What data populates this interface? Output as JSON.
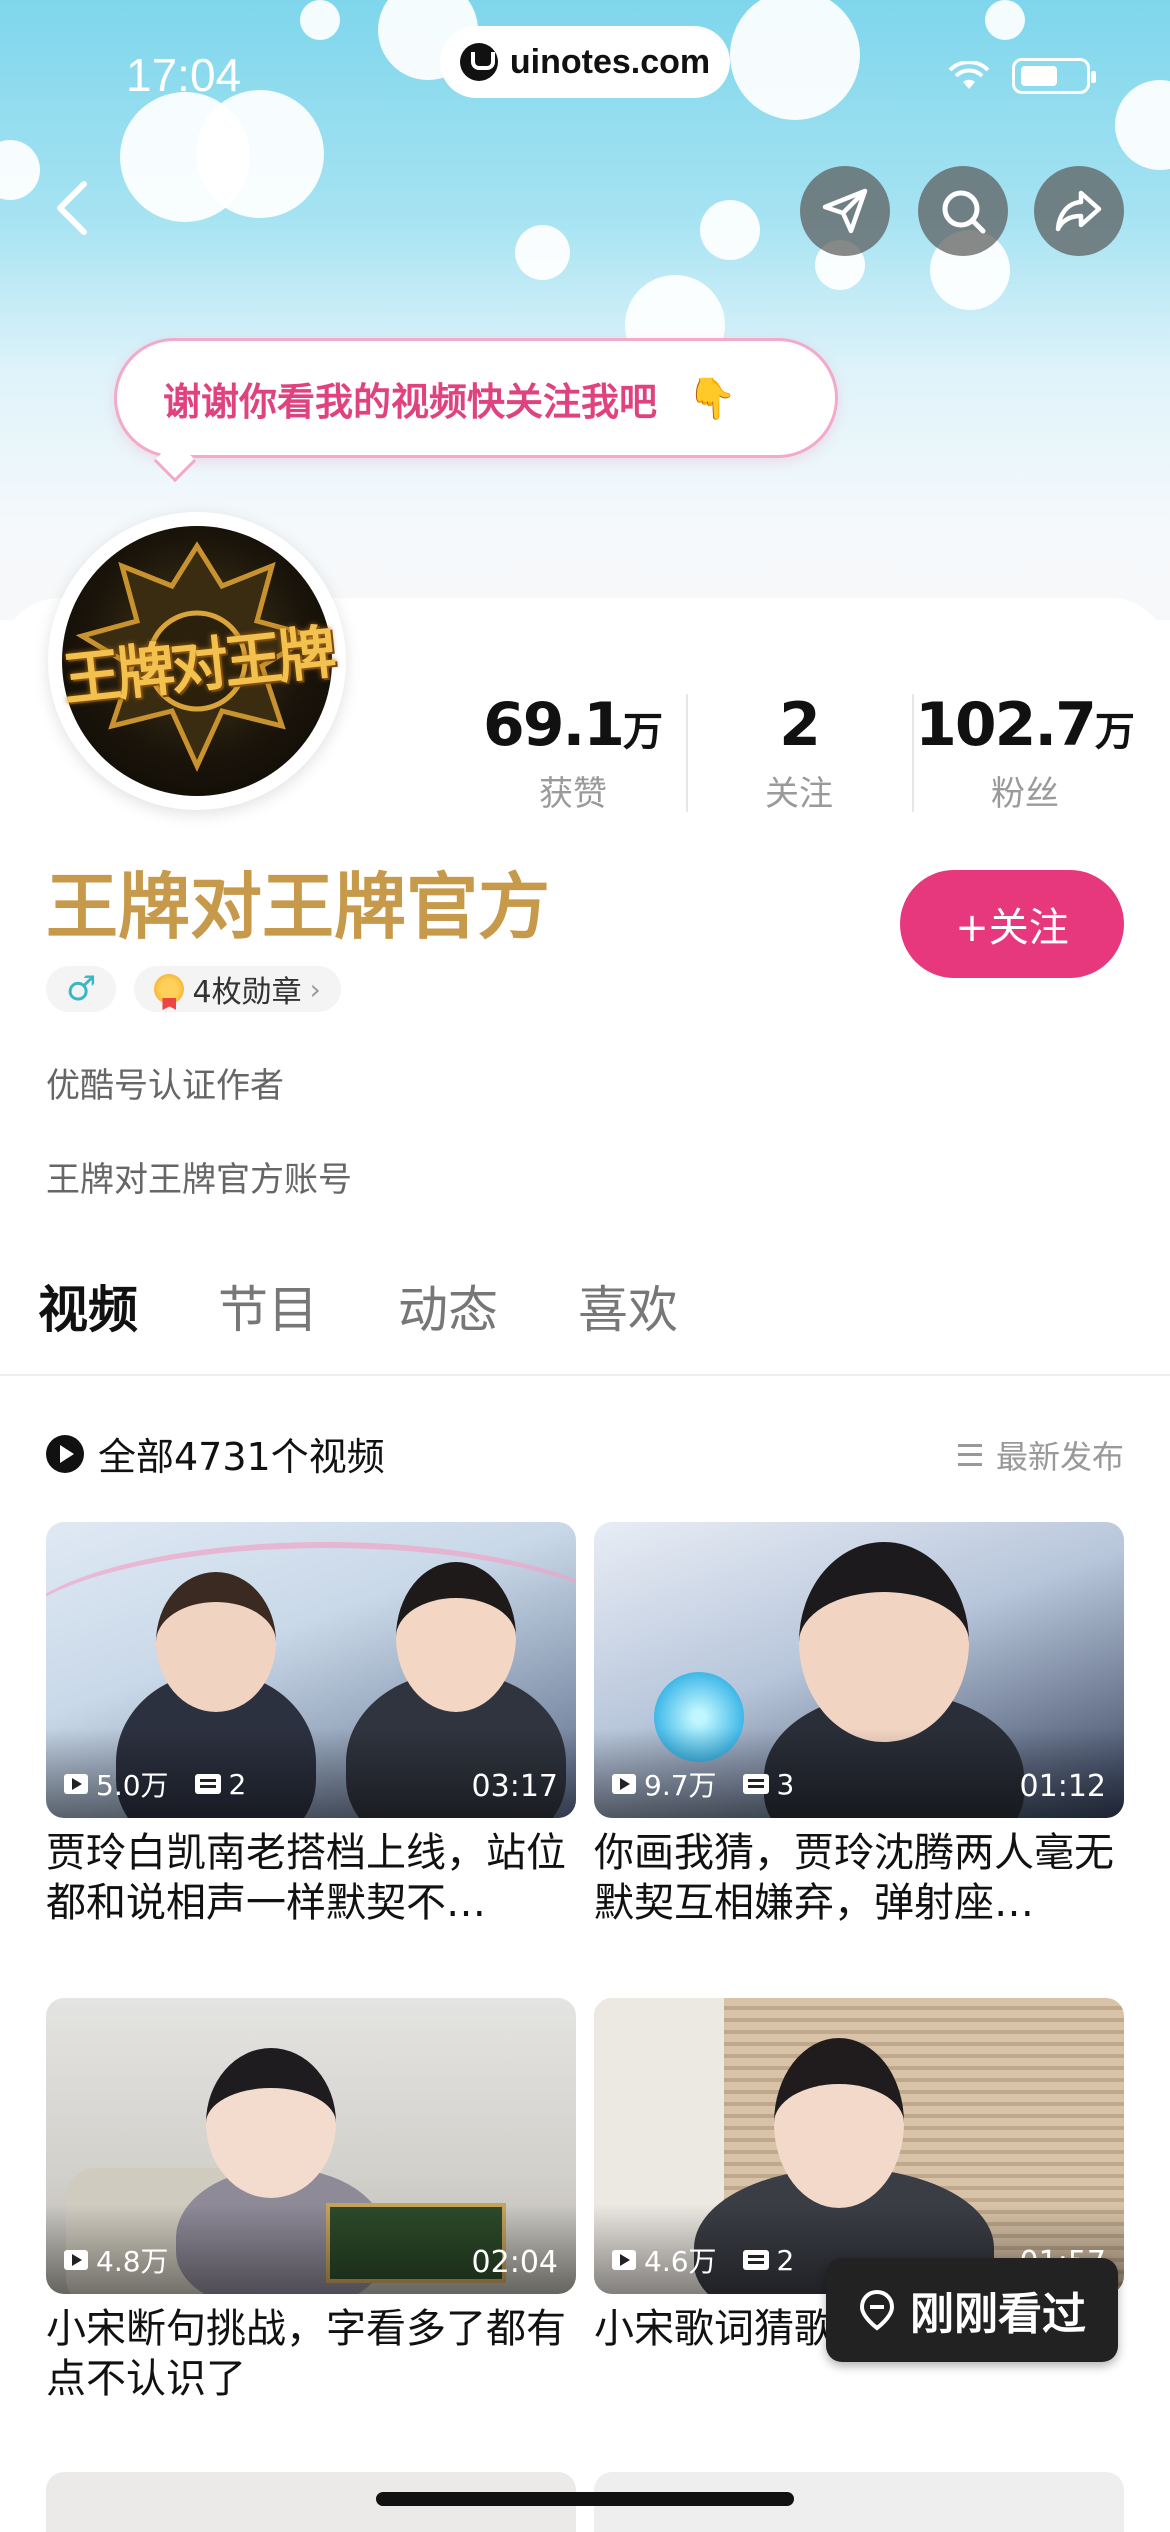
{
  "status_bar": {
    "time": "17:04"
  },
  "watermark": {
    "text": "uinotes.com"
  },
  "speech_bubble": {
    "text": "谢谢你看我的视频快关注我吧",
    "emoji": "👇"
  },
  "profile": {
    "avatar_text": "王牌对王牌",
    "name": "王牌对王牌官方",
    "follow_label": "+关注",
    "stats": [
      {
        "num": "69.1",
        "unit": "万",
        "label": "获赞"
      },
      {
        "num": "2",
        "unit": "",
        "label": "关注"
      },
      {
        "num": "102.7",
        "unit": "万",
        "label": "粉丝"
      }
    ],
    "gender_symbol": "♂",
    "medals_label": "4枚勋章",
    "verification": "优酷号认证作者",
    "bio": "王牌对王牌官方账号"
  },
  "tabs": [
    "视频",
    "节目",
    "动态",
    "喜欢"
  ],
  "list": {
    "count_label": "全部4731个视频",
    "sort_label": "最新发布"
  },
  "videos": [
    {
      "views": "5.0万",
      "danmaku": "2",
      "duration": "03:17",
      "title": "贾玲白凯南老搭档上线，站位都和说相声一样默契不…"
    },
    {
      "views": "9.7万",
      "danmaku": "3",
      "duration": "01:12",
      "title": "你画我猜，贾玲沈腾两人毫无默契互相嫌弃，弹射座…"
    },
    {
      "views": "4.8万",
      "danmaku": "",
      "duration": "02:04",
      "title": "小宋断句挑战，字看多了都有点不认识了"
    },
    {
      "views": "4.6万",
      "danmaku": "2",
      "duration": "01:57",
      "title": "小宋歌词猜歌，猜猜出来"
    }
  ],
  "recent_button": {
    "label": "刚刚看过"
  },
  "colors": {
    "accent": "#e8387d",
    "name_gold": "#c69a4a",
    "speech_pink": "#e0427f"
  }
}
